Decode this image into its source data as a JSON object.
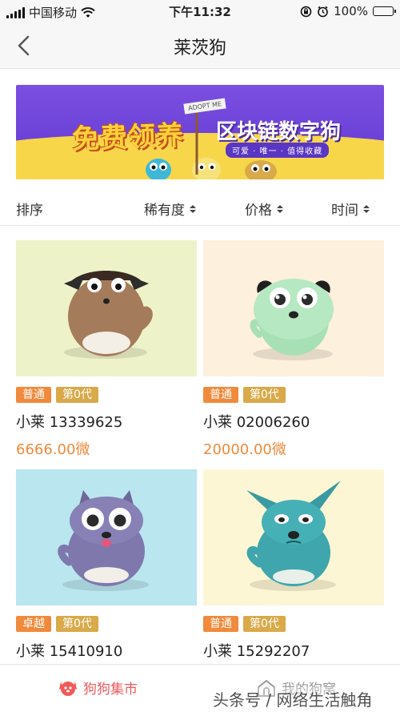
{
  "status_bar": {
    "carrier": "中国移动",
    "time": "下午11:32",
    "battery": "100%",
    "battery_level": 1.0
  },
  "nav": {
    "back_icon": "chevron-left-icon",
    "title": "莱茨狗"
  },
  "banner": {
    "title_left": "免费领养",
    "title_right": "区块链数字狗",
    "subtitle": "可爱 · 唯一 · 值得收藏",
    "sign": "ADOPT ME",
    "colors": {
      "purple": "#6a3fd6",
      "yellow": "#f7d64a"
    }
  },
  "sort": {
    "label": "排序",
    "options": [
      "稀有度",
      "价格",
      "时间"
    ]
  },
  "cards": [
    {
      "rarity": "普通",
      "generation": "第0代",
      "name": "小莱 13339625",
      "price": "6666.00微",
      "bg": "#eef2c8",
      "dog_color": "#a57c5b"
    },
    {
      "rarity": "普通",
      "generation": "第0代",
      "name": "小莱 02006260",
      "price": "20000.00微",
      "bg": "#fdf0dd",
      "dog_color": "#a8e0b6"
    },
    {
      "rarity": "卓越",
      "generation": "第0代",
      "name": "小莱 15410910",
      "price": "",
      "bg": "#b9e6ef",
      "dog_color": "#7f78ad"
    },
    {
      "rarity": "普通",
      "generation": "第0代",
      "name": "小莱 15292207",
      "price": "",
      "bg": "#fdf6d4",
      "dog_color": "#3fa6ad"
    }
  ],
  "tabs": [
    {
      "label": "狗狗集市",
      "icon": "dog-face-icon",
      "active": true
    },
    {
      "label": "我的狗窝",
      "icon": "doghouse-icon",
      "active": false
    }
  ],
  "watermark": "头条号 / 网络生活触角",
  "colors": {
    "accent": "#f08a3c",
    "tab_active": "#f25a5a"
  }
}
